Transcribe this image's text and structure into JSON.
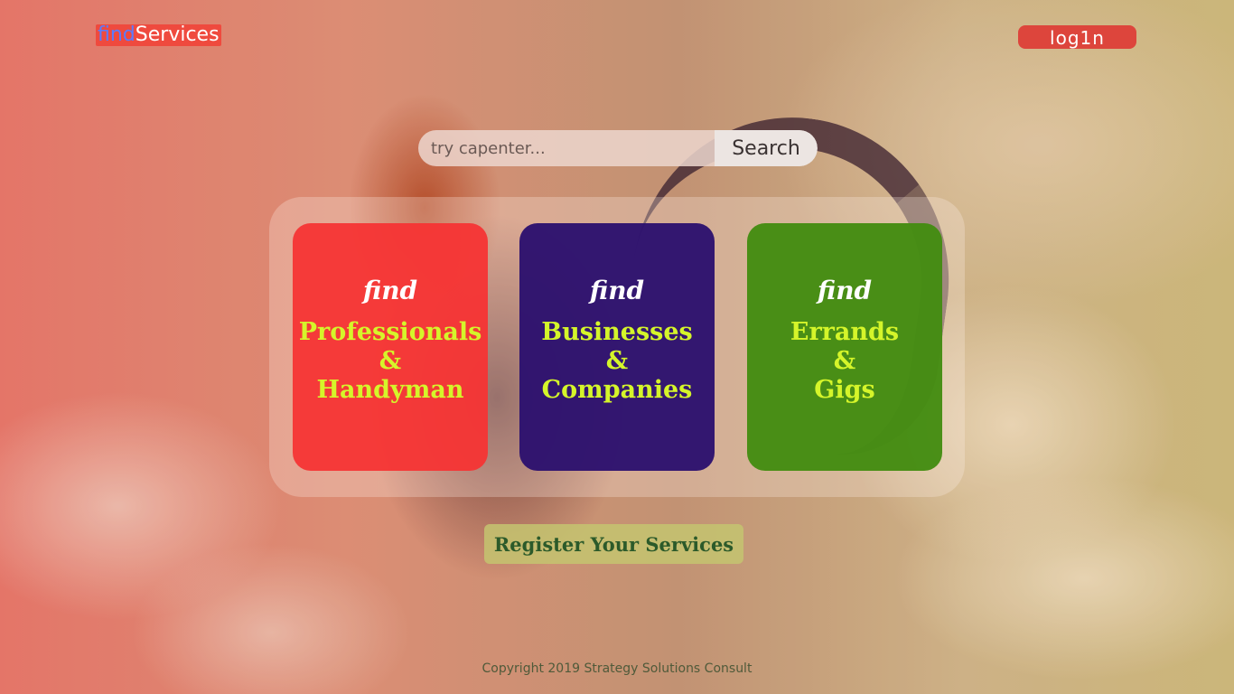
{
  "header": {
    "logo_find": "find",
    "logo_services": "Services",
    "login_label": "log1n"
  },
  "search": {
    "placeholder": "try capenter...",
    "button_label": "Search"
  },
  "cards": [
    {
      "prefix": "find",
      "line1": "Professionals",
      "line2": "&",
      "line3": "Handyman"
    },
    {
      "prefix": "find",
      "line1": "Businesses",
      "line2": "&",
      "line3": "Companies"
    },
    {
      "prefix": "find",
      "line1": "Errands",
      "line2": "&",
      "line3": "Gigs"
    }
  ],
  "register_label": "Register Your Services",
  "footer": {
    "copyright": "Copyright 2019 Strategy Solutions Consult"
  },
  "colors": {
    "card_professionals": "#f63434",
    "card_businesses": "#2d126e",
    "card_errands": "#448c12",
    "card_text": "#d5f52a",
    "login_button": "#dd453c"
  }
}
